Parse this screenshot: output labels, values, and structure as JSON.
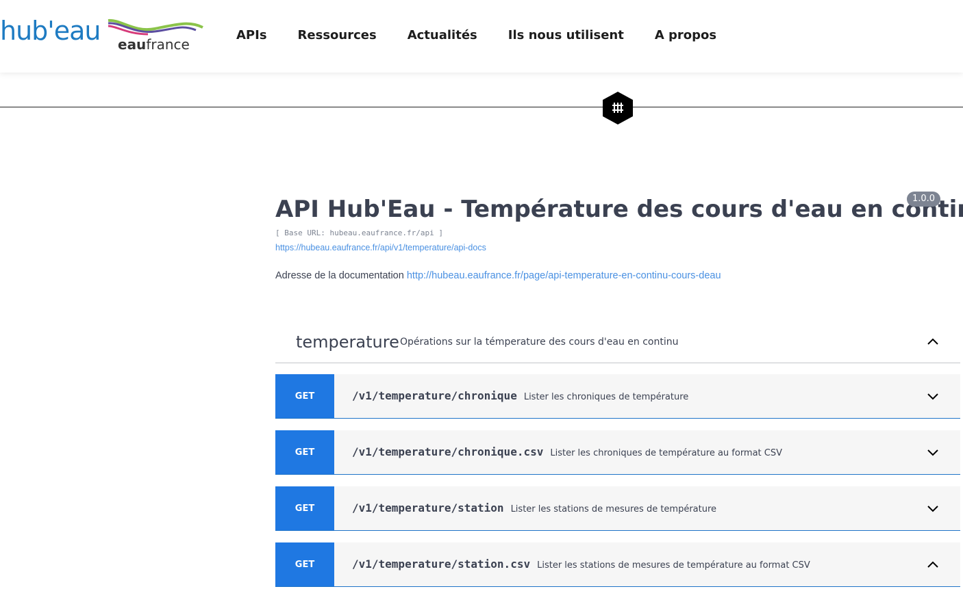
{
  "header": {
    "logo_hubeau": "hub'eau",
    "logo_eaufrance_bold": "eau",
    "logo_eaufrance_rest": "france",
    "nav": [
      "APIs",
      "Ressources",
      "Actualités",
      "Ils nous utilisent",
      "A propos"
    ]
  },
  "info": {
    "title": "API Hub'Eau - Température des cours d'eau en continu",
    "version": "1.0.0",
    "base_url": "[ Base URL: hubeau.eaufrance.fr/api ]",
    "docs_url": "https://hubeau.eaufrance.fr/api/v1/temperature/api-docs",
    "description_prefix": "Adresse de la documentation",
    "description_link": "http://hubeau.eaufrance.fr/page/api-temperature-en-continu-cours-deau"
  },
  "tag": {
    "name": "temperature",
    "description": "Opérations sur la témperature des cours d'eau en continu",
    "expanded": true
  },
  "operations": [
    {
      "method": "GET",
      "path": "/v1/temperature/chronique",
      "summary": "Lister les chroniques de température",
      "chevron": "chevron-down-icon"
    },
    {
      "method": "GET",
      "path": "/v1/temperature/chronique.csv",
      "summary": "Lister les chroniques de température au format CSV",
      "chevron": "chevron-down-icon"
    },
    {
      "method": "GET",
      "path": "/v1/temperature/station",
      "summary": "Lister les stations de mesures de température",
      "chevron": "chevron-down-icon"
    },
    {
      "method": "GET",
      "path": "/v1/temperature/station.csv",
      "summary": "Lister les stations de mesures de température au format CSV",
      "chevron": "chevron-up-icon"
    }
  ],
  "colors": {
    "get_method": "#1f78e2",
    "link": "#4990e2",
    "brand_blue": "#1e7bc2"
  }
}
